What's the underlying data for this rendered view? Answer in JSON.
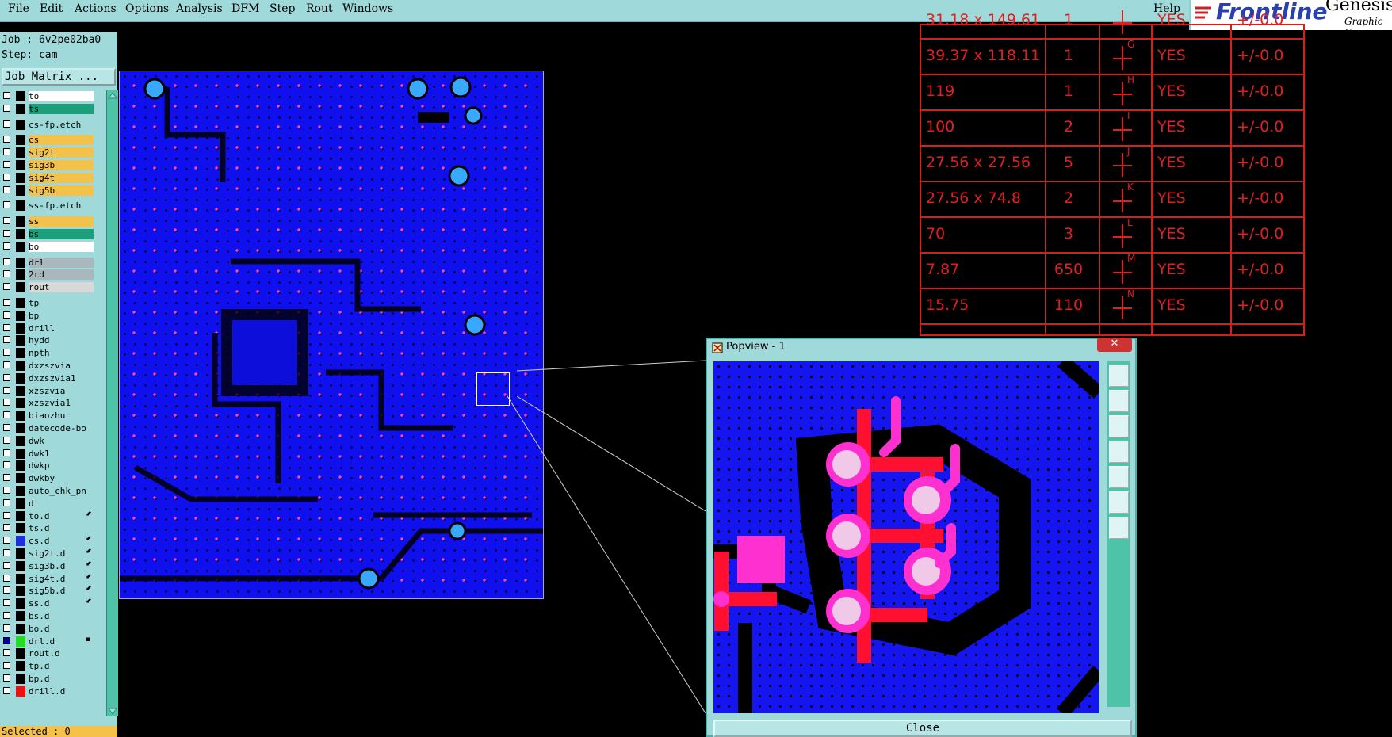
{
  "menu": [
    "File",
    "Edit",
    "Actions",
    "Options",
    "Analysis",
    "DFM",
    "Step",
    "Rout",
    "Windows"
  ],
  "help_label": "Help",
  "brand": {
    "name": "Frontline",
    "product": "Genesis",
    "sub": "Graphic E"
  },
  "job": {
    "job_line": "Job : 6v2pe02ba0",
    "step_line": "Step: cam",
    "matrix_label": "Job Matrix ..."
  },
  "layers": [
    {
      "name": "to",
      "color": "#ffffff"
    },
    {
      "name": "ts",
      "color": "#1aa07a"
    },
    {
      "name": "cs-fp.etch",
      "color": "#9fd9d9"
    },
    {
      "name": "cs",
      "color": "#f4c24a"
    },
    {
      "name": "sig2t",
      "color": "#f4c24a"
    },
    {
      "name": "sig3b",
      "color": "#f4c24a"
    },
    {
      "name": "sig4t",
      "color": "#f4c24a"
    },
    {
      "name": "sig5b",
      "color": "#f4c24a"
    },
    {
      "name": "ss-fp.etch",
      "color": "#9fd9d9"
    },
    {
      "name": "ss",
      "color": "#f4c24a"
    },
    {
      "name": "bs",
      "color": "#1aa07a"
    },
    {
      "name": "bo",
      "color": "#ffffff"
    },
    {
      "name": "drl",
      "color": "#a8b8bc"
    },
    {
      "name": "2rd",
      "color": "#a8b8bc"
    },
    {
      "name": "rout",
      "color": "#d8d8d8"
    },
    {
      "name": "tp",
      "color": "#9fd9d9"
    },
    {
      "name": "bp",
      "color": "#9fd9d9"
    },
    {
      "name": "drill",
      "color": "#9fd9d9"
    },
    {
      "name": "hydd",
      "color": "#9fd9d9"
    },
    {
      "name": "npth",
      "color": "#9fd9d9"
    },
    {
      "name": "dxzszvia",
      "color": "#9fd9d9"
    },
    {
      "name": "dxzszvia1",
      "color": "#9fd9d9"
    },
    {
      "name": "xzszvia",
      "color": "#9fd9d9"
    },
    {
      "name": "xzszvia1",
      "color": "#9fd9d9"
    },
    {
      "name": "biaozhu",
      "color": "#9fd9d9"
    },
    {
      "name": "datecode-bo",
      "color": "#9fd9d9"
    },
    {
      "name": "dwk",
      "color": "#9fd9d9"
    },
    {
      "name": "dwk1",
      "color": "#9fd9d9"
    },
    {
      "name": "dwkp",
      "color": "#9fd9d9"
    },
    {
      "name": "dwkby",
      "color": "#9fd9d9"
    },
    {
      "name": "auto_chk_pn",
      "color": "#9fd9d9"
    },
    {
      "name": "d",
      "color": "#9fd9d9"
    },
    {
      "name": "to.d",
      "color": "#9fd9d9",
      "flag": "⬋"
    },
    {
      "name": "ts.d",
      "color": "#9fd9d9"
    },
    {
      "name": "cs.d",
      "color": "#9fd9d9",
      "flag": "⬋",
      "swatch": "#1f2fdf"
    },
    {
      "name": "sig2t.d",
      "color": "#9fd9d9",
      "flag": "⬋"
    },
    {
      "name": "sig3b.d",
      "color": "#9fd9d9",
      "flag": "⬋"
    },
    {
      "name": "sig4t.d",
      "color": "#9fd9d9",
      "flag": "⬋"
    },
    {
      "name": "sig5b.d",
      "color": "#9fd9d9",
      "flag": "⬋"
    },
    {
      "name": "ss.d",
      "color": "#9fd9d9",
      "flag": "⬋"
    },
    {
      "name": "bs.d",
      "color": "#9fd9d9"
    },
    {
      "name": "bo.d",
      "color": "#9fd9d9"
    },
    {
      "name": "drl.d",
      "color": "#9fd9d9",
      "flag": "▪",
      "swatch": "#22dd22",
      "checked": true
    },
    {
      "name": "rout.d",
      "color": "#9fd9d9"
    },
    {
      "name": "tp.d",
      "color": "#9fd9d9"
    },
    {
      "name": "bp.d",
      "color": "#9fd9d9"
    },
    {
      "name": "drill.d",
      "color": "#9fd9d9",
      "swatch": "#ee1111"
    }
  ],
  "status": "Selected : 0",
  "drill_table": [
    {
      "size": "31.18 x 149.61",
      "count": "1",
      "sym": "",
      "plated": "YES",
      "tol": "+/-0.0"
    },
    {
      "size": "39.37 x 118.11",
      "count": "1",
      "sym": "G",
      "plated": "YES",
      "tol": "+/-0.0"
    },
    {
      "size": "119",
      "count": "1",
      "sym": "H",
      "plated": "YES",
      "tol": "+/-0.0"
    },
    {
      "size": "100",
      "count": "2",
      "sym": "I",
      "plated": "YES",
      "tol": "+/-0.0"
    },
    {
      "size": "27.56 x 27.56",
      "count": "5",
      "sym": "J",
      "plated": "YES",
      "tol": "+/-0.0"
    },
    {
      "size": "27.56 x 74.8",
      "count": "2",
      "sym": "K",
      "plated": "YES",
      "tol": "+/-0.0"
    },
    {
      "size": "70",
      "count": "3",
      "sym": "L",
      "plated": "YES",
      "tol": "+/-0.0"
    },
    {
      "size": "7.87",
      "count": "650",
      "sym": "M",
      "plated": "YES",
      "tol": "+/-0.0"
    },
    {
      "size": "15.75",
      "count": "110",
      "sym": "N",
      "plated": "YES",
      "tol": "+/-0.0"
    }
  ],
  "popview": {
    "title": "Popview - 1",
    "close_label": "Close"
  }
}
